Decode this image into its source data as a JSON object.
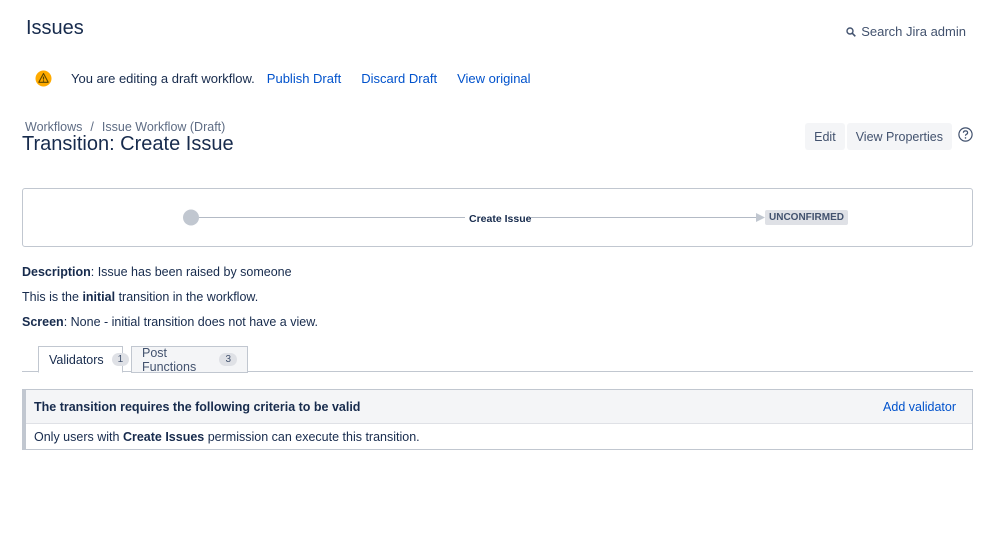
{
  "header": {
    "title": "Issues",
    "search_label": "Search Jira admin"
  },
  "draft_bar": {
    "message": "You are editing a draft workflow.",
    "publish": "Publish Draft",
    "discard": "Discard Draft",
    "view_original": "View original"
  },
  "breadcrumb": {
    "workflows": "Workflows",
    "separator": "/",
    "current": "Issue Workflow (Draft)"
  },
  "transition_title": "Transition: Create Issue",
  "actions": {
    "edit": "Edit",
    "view_properties": "View Properties"
  },
  "diagram": {
    "transition_label": "Create Issue",
    "target_status": "UNCONFIRMED"
  },
  "details": {
    "description_label": "Description",
    "description_value": ": Issue has been raised by someone",
    "initial_prefix": "This is the ",
    "initial_word": "initial",
    "initial_suffix": " transition in the workflow.",
    "screen_label": "Screen",
    "screen_value": ": None - initial transition does not have a view."
  },
  "tabs": [
    {
      "label": "Validators",
      "count": "1"
    },
    {
      "label": "Post Functions",
      "count": "3"
    }
  ],
  "criteria": {
    "title": "The transition requires the following criteria to be valid",
    "add_label": "Add validator",
    "body_prefix": "Only users with ",
    "body_bold": "Create Issues",
    "body_suffix": " permission can execute this transition."
  },
  "icons": {
    "search": "search-icon",
    "warning": "warning-icon",
    "help": "help-icon"
  },
  "colors": {
    "link": "#0052cc",
    "warning": "#ffab00",
    "panel_bg": "#f4f5f7"
  }
}
